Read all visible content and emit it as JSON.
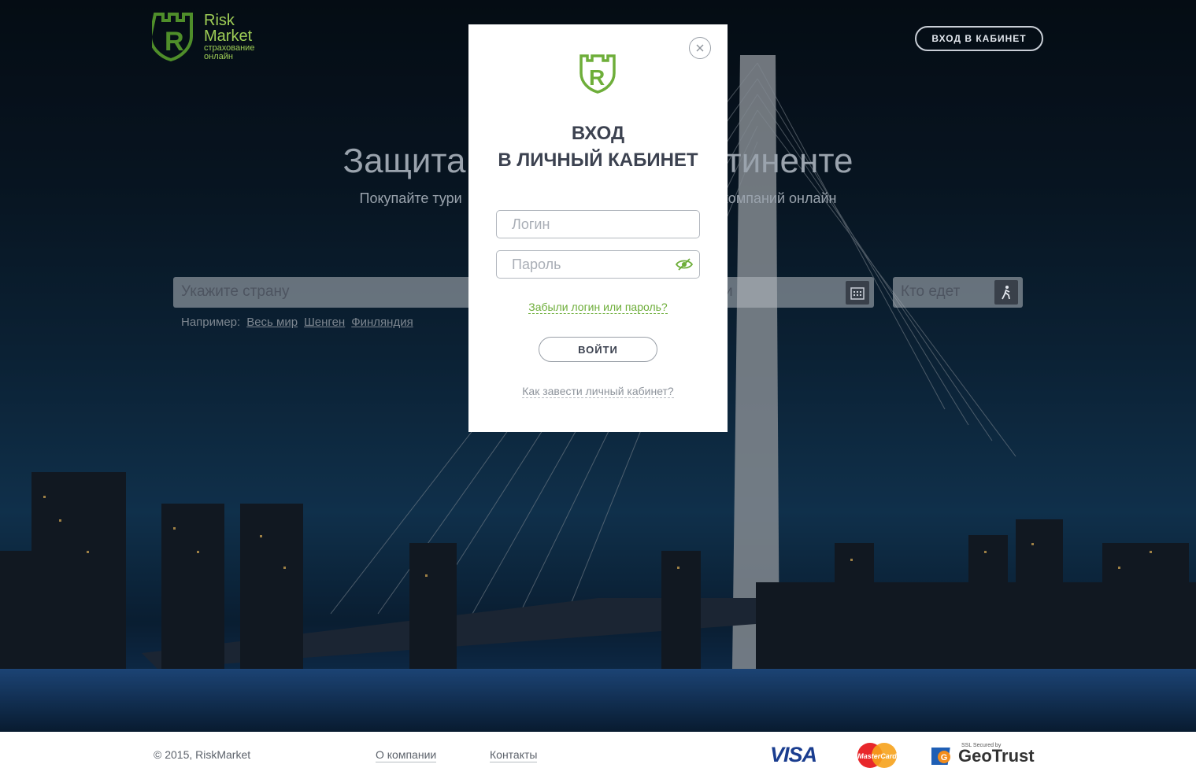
{
  "header": {
    "logo": {
      "line1": "Risk",
      "line2": "Market",
      "line3": "страхование",
      "line4": "онлайн"
    },
    "cabinet_button": "ВХОД В КАБИНЕТ"
  },
  "hero": {
    "headline_left": "Защита",
    "headline_right": "тиненте",
    "subline_left": "Покупайте тури",
    "subline_right": "компаний онлайн"
  },
  "search": {
    "country_placeholder": "Укажите страну",
    "dates_placeholder": "и",
    "who_placeholder": "Кто едет",
    "examples_label": "Например:",
    "examples": [
      "Весь мир",
      "Шенген",
      "Финляндия"
    ]
  },
  "modal": {
    "title_line1": "ВХОД",
    "title_line2": "В ЛИЧНЫЙ КАБИНЕТ",
    "login_placeholder": "Логин",
    "password_placeholder": "Пароль",
    "forgot_link": "Забыли логин или пароль?",
    "submit_button": "ВОЙТИ",
    "howto_link": "Как завести личный кабинет?"
  },
  "footer": {
    "copyright": "© 2015, RiskMarket",
    "links": [
      "О компании",
      "Контакты"
    ],
    "payment": {
      "visa": "VISA",
      "mastercard": "MasterCard",
      "geotrust": "GeoTrust",
      "geotrust_small": "SSL Secured by"
    }
  },
  "colors": {
    "brand_green": "#6eae3a",
    "dark_text": "#3c4250"
  }
}
